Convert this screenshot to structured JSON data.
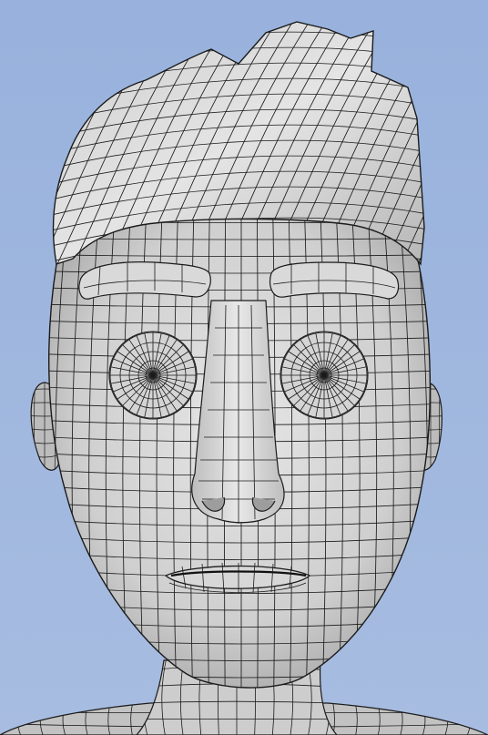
{
  "viewport": {
    "background_top": "#98b2dd",
    "background_bottom": "#a7bce0",
    "mesh_fill": "#c9c9c9",
    "mesh_fill_light": "#e2e2e2",
    "wire_color": "#1b1b1b"
  }
}
